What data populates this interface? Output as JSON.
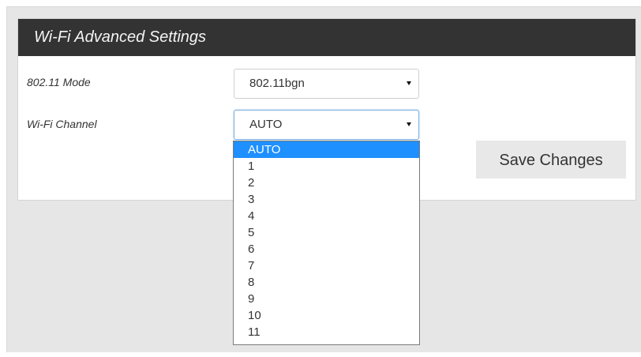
{
  "panel": {
    "title": "Wi-Fi Advanced Settings"
  },
  "mode": {
    "label": "802.11 Mode",
    "value": "802.11bgn"
  },
  "channel": {
    "label": "Wi-Fi Channel",
    "value": "AUTO",
    "options": [
      "AUTO",
      "1",
      "2",
      "3",
      "4",
      "5",
      "6",
      "7",
      "8",
      "9",
      "10",
      "11"
    ],
    "highlighted_index": 0
  },
  "actions": {
    "save_label": "Save Changes"
  },
  "colors": {
    "header_bg": "#333333",
    "highlight": "#1e90ff",
    "page_bg": "#e6e6e6"
  }
}
